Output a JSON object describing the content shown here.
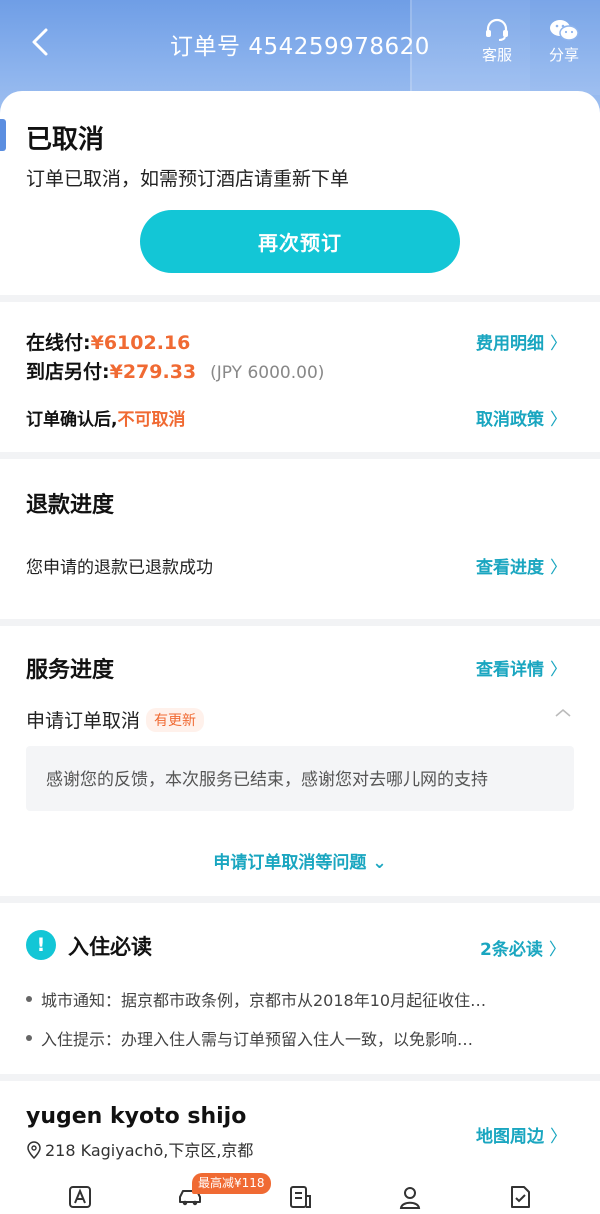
{
  "header": {
    "title": "订单号 454259978620",
    "service_label": "客服",
    "share_label": "分享"
  },
  "status": {
    "title": "已取消",
    "description": "订单已取消，如需预订酒店请重新下单",
    "rebook_label": "再次预订"
  },
  "payment": {
    "online_label": "在线付:",
    "online_amount": "¥6102.16",
    "store_label": "到店另付:",
    "store_amount": "¥279.33",
    "store_jpy": "(JPY 6000.00)",
    "fee_detail_link": "费用明细",
    "cancel_note_prefix": "订单确认后,",
    "cancel_note_warn": "不可取消",
    "cancel_policy_link": "取消政策"
  },
  "refund": {
    "title": "退款进度",
    "description": "您申请的退款已退款成功",
    "progress_link": "查看进度"
  },
  "service": {
    "title": "服务进度",
    "detail_link": "查看详情",
    "item_label": "申请订单取消",
    "item_badge": "有更新",
    "message": "感谢您的反馈，本次服务已结束，感谢您对去哪儿网的支持",
    "more_link": "申请订单取消等问题"
  },
  "checkin": {
    "title": "入住必读",
    "count_link": "2条必读",
    "notes": [
      "城市通知：据京都市政条例，京都市从2018年10月起征收住…",
      "入住提示：办理入住人需与订单预留入住人一致，以免影响…"
    ]
  },
  "hotel": {
    "name": "yugen kyoto shijo",
    "address": "218 Kagiyachō,下京区,京都",
    "map_link": "地图周边"
  },
  "bottom": {
    "promo_badge": "最高减¥118"
  },
  "colors": {
    "accent": "#13c6d6",
    "link": "#1aa6c0",
    "warning": "#f06a33"
  }
}
